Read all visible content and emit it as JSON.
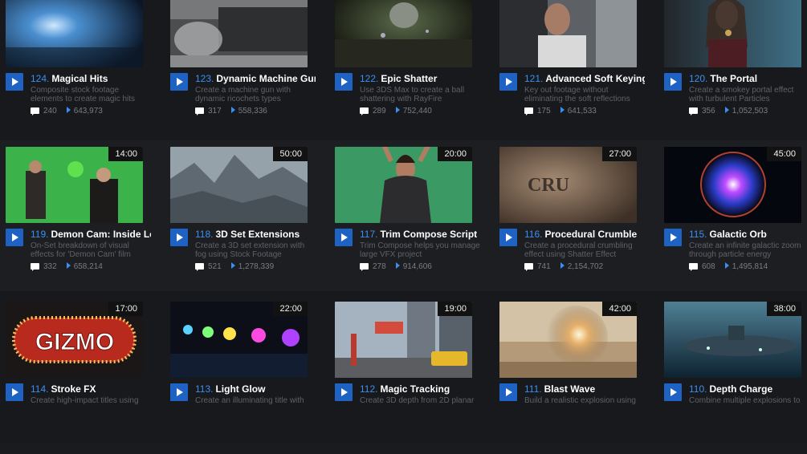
{
  "courses": [
    {
      "number": "124.",
      "title": "Magical Hits",
      "description": "Composite stock footage elements to create magic hits",
      "comments": "240",
      "views": "643,973",
      "duration": "",
      "thumb_icon": "magic-burst-thumbnail"
    },
    {
      "number": "123.",
      "title": "Dynamic Machine Gun",
      "description": "Create a machine gun with dynamic ricochets types",
      "comments": "317",
      "views": "558,336",
      "duration": "",
      "thumb_icon": "concrete-wall-debris-thumbnail"
    },
    {
      "number": "122.",
      "title": "Epic Shatter",
      "description": "Use 3DS Max to create a ball shattering with RayFire",
      "comments": "289",
      "views": "752,440",
      "duration": "",
      "thumb_icon": "shattering-ball-thumbnail"
    },
    {
      "number": "121.",
      "title": "Advanced Soft Keying",
      "description": "Key out footage without eliminating the soft reflections",
      "comments": "175",
      "views": "641,533",
      "duration": "",
      "thumb_icon": "driver-in-car-thumbnail"
    },
    {
      "number": "120.",
      "title": "The Portal",
      "description": "Create a smokey portal effect with turbulent Particles",
      "comments": "356",
      "views": "1,052,503",
      "duration": "",
      "thumb_icon": "woman-portrait-thumbnail"
    },
    {
      "number": "119.",
      "title": "Demon Cam: Inside Lo...",
      "description": "On-Set breakdown of visual effects for 'Demon Cam' film",
      "comments": "332",
      "views": "658,214",
      "duration": "14:00",
      "thumb_icon": "greenscreen-fight-thumbnail"
    },
    {
      "number": "118.",
      "title": "3D Set Extensions",
      "description": "Create a 3D set extension with fog using Stock Footage",
      "comments": "521",
      "views": "1,278,339",
      "duration": "50:00",
      "thumb_icon": "foggy-mountains-thumbnail"
    },
    {
      "number": "117.",
      "title": "Trim Compose Script",
      "description": "Trim Compose helps you manage large VFX project",
      "comments": "278",
      "views": "914,606",
      "duration": "20:00",
      "thumb_icon": "dancer-greenscreen-thumbnail"
    },
    {
      "number": "116.",
      "title": "Procedural Crumble",
      "description": "Create a procedural crumbling effect using Shatter Effect",
      "comments": "741",
      "views": "2,154,702",
      "duration": "27:00",
      "thumb_icon": "crumbling-text-thumbnail"
    },
    {
      "number": "115.",
      "title": "Galactic Orb",
      "description": "Create an infinite galactic zoom through particle energy",
      "comments": "608",
      "views": "1,495,814",
      "duration": "45:00",
      "thumb_icon": "energy-orb-thumbnail"
    },
    {
      "number": "114.",
      "title": "Stroke FX",
      "description": "Create high-impact titles using",
      "comments": "",
      "views": "",
      "duration": "17:00",
      "thumb_icon": "gizmo-sign-thumbnail",
      "thumb_text": "GIZMO"
    },
    {
      "number": "113.",
      "title": "Light Glow",
      "description": "Create an illuminating title with",
      "comments": "",
      "views": "",
      "duration": "22:00",
      "thumb_icon": "glowing-lights-thumbnail"
    },
    {
      "number": "112.",
      "title": "Magic Tracking",
      "description": "Create 3D depth from 2D planar",
      "comments": "",
      "views": "",
      "duration": "19:00",
      "thumb_icon": "city-street-taxi-thumbnail"
    },
    {
      "number": "111.",
      "title": "Blast Wave",
      "description": "Build a realistic explosion using",
      "comments": "",
      "views": "",
      "duration": "42:00",
      "thumb_icon": "desert-explosion-thumbnail"
    },
    {
      "number": "110.",
      "title": "Depth Charge",
      "description": "Combine multiple explosions to",
      "comments": "",
      "views": "",
      "duration": "38:00",
      "thumb_icon": "submarine-thumbnail"
    }
  ],
  "colors": {
    "accent": "#1e63c3",
    "number": "#3b8ff0",
    "background": "#1a1b1f"
  }
}
